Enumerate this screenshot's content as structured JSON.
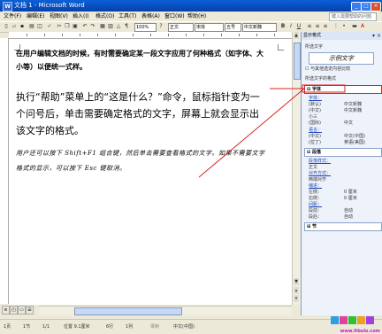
{
  "window": {
    "title": "文档 1 - Microsoft Word",
    "icon_label": "W",
    "minimize": "_",
    "maximize": "□",
    "close": "×"
  },
  "menu": {
    "items": [
      "文件(F)",
      "编辑(E)",
      "视图(V)",
      "插入(I)",
      "格式(O)",
      "工具(T)",
      "表格(A)",
      "窗口(W)",
      "帮助(H)"
    ],
    "help_placeholder": "键入需要帮助的问题"
  },
  "toolbar": {
    "zoom": "100%",
    "style": "正文",
    "font": "宋体",
    "size": "五号",
    "font_style_label": "中文新魏"
  },
  "document": {
    "para1": "在用户编辑文档的时候，有时需要确定某一段文字应用了何种格式（如字体、大小等）以便统一式样。",
    "para2": "执行“帮助”菜单上的“这是什么？”命令，鼠标指针变为一个问号后，单击需要确定格式的文字，屏幕上就会显示出该文字的格式。",
    "para3": "用户还可以按下 Shift+F1 组合键，然后单击需要查看格式的文字。如果不需要文字格式的显示，可以按下 Esc 键取消。"
  },
  "pane": {
    "header": "显示格式",
    "selected_label": "所选文字",
    "sample_text": "示例文字",
    "compare_checkbox": "与其他选定内容比较",
    "format_label": "所选文字的格式",
    "font_section": "字体",
    "font_rows": [
      {
        "left": "字体：",
        "right": ""
      },
      {
        "left": "(默认)",
        "right": "中文新魏"
      },
      {
        "left": "(中文)",
        "right": "中文新魏"
      },
      {
        "left": "小三",
        "right": ""
      },
      {
        "left": "(国际)",
        "right": "中文"
      }
    ],
    "language_link": "语言：",
    "language_rows": [
      {
        "left": "(中文)",
        "right": "中文(中国)"
      },
      {
        "left": "(拉丁)",
        "right": "英语(美国)"
      }
    ],
    "para_section": "段落",
    "para_rows": [
      {
        "left": "段落样式：",
        "right": ""
      },
      {
        "left": "正文",
        "right": ""
      },
      {
        "left": "对齐方式：",
        "right": ""
      },
      {
        "left": "两端对齐",
        "right": ""
      },
      {
        "left": "缩进：",
        "right": ""
      },
      {
        "left": "左侧：",
        "right": "0 厘米"
      },
      {
        "left": "右侧：",
        "right": "0 厘米"
      },
      {
        "left": "间距：",
        "right": ""
      },
      {
        "left": "段前：",
        "right": "自动"
      },
      {
        "left": "段后：",
        "right": "自动"
      }
    ],
    "section_section": "节"
  },
  "status": {
    "page": "1页",
    "section": "1节",
    "pages": "1/1",
    "position": "位置 9.1厘米",
    "line": "6行",
    "column": "1列",
    "rec": "录制",
    "lang": "中文(中国)"
  },
  "watermark": {
    "text": "www.itbulo.com"
  }
}
